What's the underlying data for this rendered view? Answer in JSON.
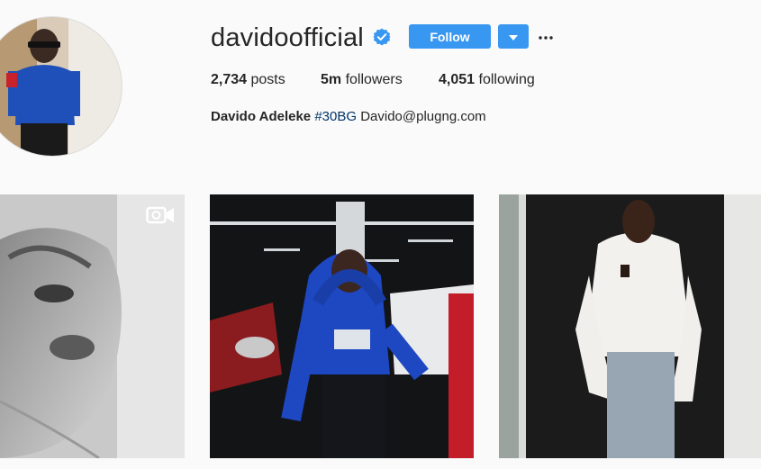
{
  "profile": {
    "username": "davidoofficial",
    "verified_icon": "verified-badge-icon",
    "follow_label": "Follow",
    "dropdown_icon": "caret-down-icon",
    "more_icon": "more-options-icon",
    "avatar_icon": "profile-avatar"
  },
  "stats": {
    "posts_count": "2,734",
    "posts_label": "posts",
    "followers_count": "5m",
    "followers_label": "followers",
    "following_count": "4,051",
    "following_label": "following"
  },
  "bio": {
    "full_name": "Davido Adeleke",
    "hashtag": "#30BG",
    "contact": "Davido@plugng.com"
  },
  "posts": [
    {
      "type": "video",
      "icon": "video-camera-icon"
    },
    {
      "type": "photo"
    },
    {
      "type": "photo"
    }
  ],
  "colors": {
    "accent": "#3897f0",
    "background": "#fafafa",
    "text": "#262626",
    "hashtag": "#003569"
  }
}
